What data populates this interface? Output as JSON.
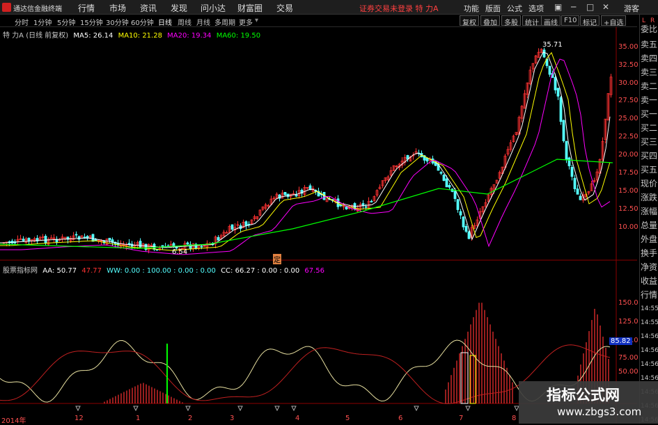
{
  "app": {
    "name": "通达信金融终端",
    "status": "证券交易未登录",
    "stock": "特 力A"
  },
  "menu": [
    "行情",
    "市场",
    "资讯",
    "发现",
    "问小达",
    "财富圈",
    "交易"
  ],
  "right_menu": [
    "功能",
    "版面",
    "公式",
    "选项"
  ],
  "guest": "游客",
  "timeframes": [
    "分时",
    "1分钟",
    "5分钟",
    "15分钟",
    "30分钟",
    "60分钟",
    "日线",
    "周线",
    "月线",
    "多周期",
    "更多"
  ],
  "active_timeframe": "日线",
  "tool_buttons": [
    "复权",
    "叠加",
    "多股",
    "统计",
    "画线",
    "F10",
    "标记",
    "+自选"
  ],
  "ma_line": {
    "name": "特 力A (日线 前复权)",
    "ma5": "MA5: 26.14",
    "ma10": "MA10: 21.28",
    "ma20": "MA20: 19.34",
    "ma60": "MA60: 19.50"
  },
  "price_labels": {
    "high": "35.71",
    "low": "6.54",
    "marker": "定"
  },
  "price_axis": [
    "35.00",
    "32.50",
    "30.00",
    "27.50",
    "25.00",
    "22.50",
    "20.00",
    "17.50",
    "15.00",
    "12.50",
    "10.00"
  ],
  "indicator_line": {
    "name": "股票指标网",
    "aa": "AA: 50.77",
    "aa2": "47.77",
    "ww": "WW: 0.00 : 100.00 : 0.00 : 0.00",
    "cc": "CC: 66.27 : 0.00 : 0.00",
    "cc2": "67.56"
  },
  "indicator_axis": [
    "150.0",
    "125.0",
    "100.0",
    "75.00",
    "50.00"
  ],
  "indicator_highlight": "85.82",
  "x_axis": [
    "2014年",
    "12",
    "1",
    "2",
    "3",
    "4",
    "5",
    "6",
    "7",
    "8"
  ],
  "right_panel": [
    "L",
    "R",
    "委比",
    "卖五",
    "卖四",
    "卖三",
    "卖二",
    "卖一",
    "买一",
    "买二",
    "买三",
    "买四",
    "买五",
    "现价",
    "涨跌",
    "涨幅",
    "总量",
    "外盘",
    "换手",
    "净资",
    "收益",
    "行情",
    "14:55",
    "14:55",
    "14:56",
    "14:56",
    "14:56",
    "14:56",
    "14:56",
    "14:56",
    "14:56"
  ],
  "watermark": {
    "line1": "指标公式网",
    "line2": "www.zbgs3.com"
  },
  "colors": {
    "up": "#ff3232",
    "down": "#54ffff",
    "ma5": "#ffffff",
    "ma10": "#ffff00",
    "ma20": "#ff00ff",
    "ma60": "#00ff00",
    "accent": "#ff4040"
  }
}
